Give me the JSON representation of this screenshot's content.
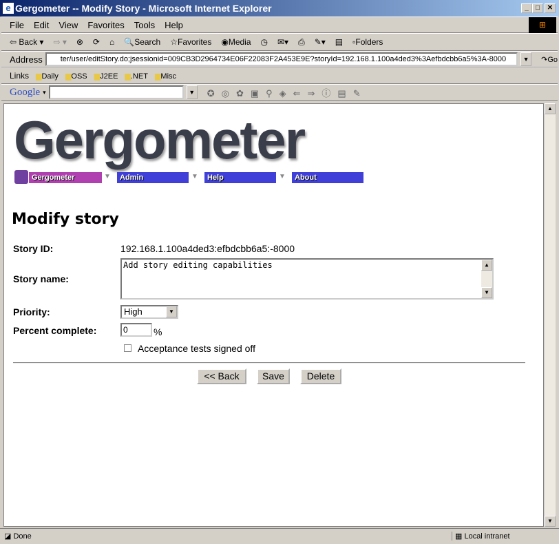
{
  "window": {
    "title": "Gergometer -- Modify Story - Microsoft Internet Explorer"
  },
  "menu": [
    "File",
    "Edit",
    "View",
    "Favorites",
    "Tools",
    "Help"
  ],
  "toolbar": {
    "back": "Back",
    "search": "Search",
    "favorites": "Favorites",
    "media": "Media",
    "folders": "Folders"
  },
  "address": {
    "label": "Address",
    "url": "ter/user/editStory.do;jsessionid=009CB3D2964734E06F22083F2A453E9E?storyId=192.168.1.100a4ded3%3Aefbdcbb6a5%3A-8000",
    "go": "Go"
  },
  "links": {
    "label": "Links",
    "items": [
      "Daily",
      "OSS",
      "J2EE",
      ".NET",
      "Misc"
    ]
  },
  "google": {
    "logo": "Google"
  },
  "page": {
    "logo": "Gergometer",
    "nav": [
      {
        "label": "Gergometer",
        "color": "#b040b0"
      },
      {
        "label": "Admin",
        "color": "#4040d8"
      },
      {
        "label": "Help",
        "color": "#4040d8"
      },
      {
        "label": "About",
        "color": "#4040d8"
      }
    ],
    "heading": "Modify story",
    "form": {
      "story_id_label": "Story ID:",
      "story_id": "192.168.1.100a4ded3:efbdcbb6a5:-8000",
      "story_name_label": "Story name:",
      "story_name": "Add story editing capabilities",
      "priority_label": "Priority:",
      "priority": "High",
      "percent_label": "Percent complete:",
      "percent": "0",
      "percent_unit": "%",
      "acceptance_label": "Acceptance tests signed off",
      "acceptance_checked": false
    },
    "buttons": {
      "back": "<< Back",
      "save": "Save",
      "delete": "Delete"
    }
  },
  "status": {
    "text": "Done",
    "zone": "Local intranet"
  }
}
